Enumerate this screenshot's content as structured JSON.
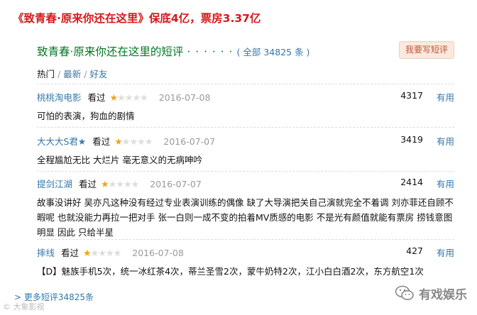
{
  "headline": "《致青春·原来你还在这里》保底4亿，票房3.37亿",
  "section": {
    "title": "致青春·原来你还在这里的短评",
    "dots": "· · · · · ·",
    "count": "( 全部 34825 条 )",
    "write_button": "我要写短评"
  },
  "tabs": {
    "active": "热门",
    "sep": "/",
    "latest": "最新",
    "friends": "好友"
  },
  "colors": {
    "headline": "#d3191b",
    "title_green": "#007722",
    "link_blue": "#3377aa",
    "star_on": "#f0a51c",
    "star_off": "#dddddd",
    "button_bg": "#fbe9de"
  },
  "reviews": [
    {
      "user": "桃桃淘电影",
      "status": "看过",
      "rating": 1,
      "date": "2016-07-08",
      "votes": "4317",
      "useful": "有用",
      "text": "可怕的表演，狗血的剧情"
    },
    {
      "user": "大大大S君★",
      "status": "看过",
      "rating": 1,
      "date": "2016-07-07",
      "votes": "3419",
      "useful": "有用",
      "text": "全程尴尬无比 大烂片 毫无意义的无病呻吟"
    },
    {
      "user": "提剑江湖",
      "status": "看过",
      "rating": 1,
      "date": "2016-07-07",
      "votes": "2414",
      "useful": "有用",
      "text": "故事没讲好 吴亦凡这种没有经过专业表演训练的偶像 缺了大导演把关自己演就完全不着调 刘亦菲还自顾不暇呢 也就没能力再拉一把对手 张一白则一成不变的拍着MV质感的电影 不是光有颜值就能有票房 捞钱意图明显 因此 只给半星"
    },
    {
      "user": "摔线",
      "status": "看过",
      "rating": 1,
      "date": "2016-07-08",
      "votes": "427",
      "useful": "有用",
      "text": "【D】魅族手机5次，统一冰红茶4次，蒂兰圣雪2次，蒙牛奶特2次，江小白白酒2次，东方航空1次"
    }
  ],
  "more_link": "> 更多短评34825条",
  "watermark_left": "© 大象影视",
  "watermark_right": "有戏娱乐",
  "icons": {
    "star": "star-icon",
    "wechat": "wechat-logo-icon"
  }
}
